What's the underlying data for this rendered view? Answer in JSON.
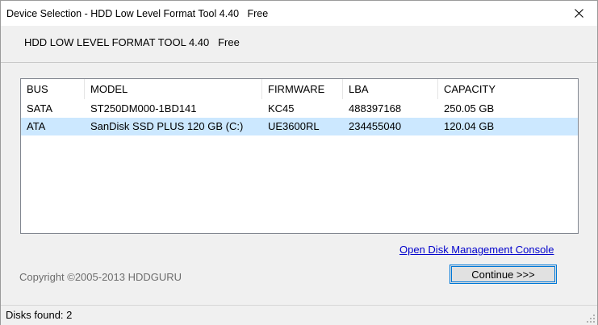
{
  "window": {
    "title": "Device Selection - HDD Low Level Format Tool 4.40   Free",
    "close_icon": "close-icon"
  },
  "header": {
    "text": "HDD LOW LEVEL FORMAT TOOL 4.40   Free"
  },
  "disk_list": {
    "columns": [
      "BUS",
      "MODEL",
      "FIRMWARE",
      "LBA",
      "CAPACITY"
    ],
    "rows": [
      [
        "SATA",
        "ST250DM000-1BD141",
        "KC45",
        "488397168",
        "250.05 GB"
      ],
      [
        "ATA",
        "SanDisk SSD PLUS 120 GB (C:)",
        "UE3600RL",
        "234455040",
        "120.04 GB"
      ]
    ],
    "selected_row": 1,
    "selected_color": "#cce8ff"
  },
  "links": {
    "disk_management": "Open Disk Management Console"
  },
  "footer": {
    "copyright": "Copyright ©2005-2013 HDDGURU",
    "continue_label": "Continue >>>"
  },
  "status": {
    "text": "Disks found: 2"
  },
  "colors": {
    "accent": "#0078d7",
    "link": "#0000cc",
    "selection": "#cce8ff"
  }
}
